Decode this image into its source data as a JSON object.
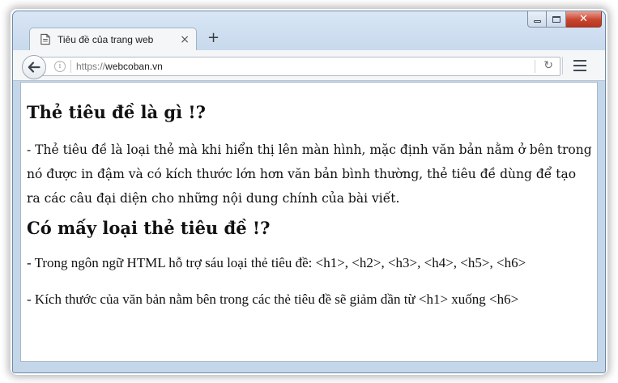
{
  "browser": {
    "tab": {
      "title": "Tiêu đề của trang web",
      "close_glyph": "×",
      "icon": "page-icon"
    },
    "new_tab_glyph": "+",
    "url": {
      "scheme": "https://",
      "host": "webcoban.vn"
    },
    "info_glyph": "i",
    "reload_glyph": "↻",
    "caption": {
      "close_glyph": "✕"
    },
    "colors": {
      "chrome": "#c4d6ea",
      "close_button": "#c9452f",
      "toolbar": "#f5f6f7"
    }
  },
  "page": {
    "heading1": "Thẻ tiêu đề là gì !?",
    "paragraph1": "- Thẻ tiêu đề là loại thẻ mà khi hiển thị lên màn hình, mặc định văn bản nằm ở bên trong nó được in đậm và có kích thước lớn hơn văn bản bình thường, thẻ tiêu đề dùng để tạo ra các câu đại diện cho những nội dung chính của bài viết.",
    "heading2": "Có mấy loại thẻ tiêu đề !?",
    "paragraph2": "- Trong ngôn ngữ HTML hỗ trợ sáu loại thẻ tiêu đề: <h1>, <h2>, <h3>, <h4>, <h5>, <h6>",
    "paragraph3": "- Kích thước của văn bản nằm bên trong các thẻ tiêu đề sẽ giảm dần từ <h1> xuống <h6>"
  }
}
